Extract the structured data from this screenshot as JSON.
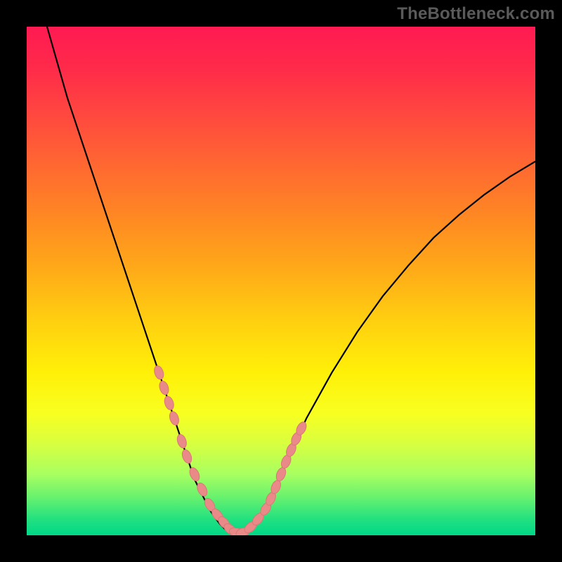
{
  "watermark": "TheBottleneck.com",
  "chart_data": {
    "type": "line",
    "title": "",
    "xlabel": "",
    "ylabel": "",
    "xlim": [
      0,
      100
    ],
    "ylim": [
      0,
      100
    ],
    "grid": false,
    "series": [
      {
        "name": "curve",
        "x": [
          4,
          6,
          8,
          10,
          12,
          14,
          16,
          18,
          20,
          22,
          24,
          26,
          28,
          30,
          31,
          32,
          33,
          34,
          35,
          36,
          37,
          38,
          39,
          40,
          41,
          42,
          43,
          44,
          45,
          46,
          48,
          50,
          52,
          55,
          60,
          65,
          70,
          75,
          80,
          85,
          90,
          95,
          100
        ],
        "y": [
          100,
          93,
          86,
          80,
          74,
          68,
          62,
          56,
          50,
          44,
          38,
          32,
          26,
          20,
          17,
          14,
          11,
          9,
          7,
          5,
          3.5,
          2.2,
          1.2,
          0.6,
          0.3,
          0.2,
          0.5,
          1.2,
          2.3,
          3.7,
          7.5,
          12,
          16.5,
          23,
          32,
          40,
          47,
          53,
          58.5,
          63,
          67,
          70.5,
          73.5
        ]
      }
    ],
    "bead_points": {
      "comment": "pink oval markers drawn along lower portion of V-curve",
      "x": [
        26,
        27,
        28,
        29,
        30.5,
        31.5,
        33,
        34.5,
        36,
        37.5,
        38.8,
        40,
        41.2,
        42.5,
        44,
        45.5,
        47,
        48,
        49,
        50,
        51,
        52,
        53,
        54
      ],
      "y": [
        32,
        29,
        26,
        23,
        18.5,
        15.5,
        12,
        9,
        6,
        4,
        2.5,
        1.2,
        0.6,
        0.6,
        1.6,
        3.2,
        5.2,
        7.2,
        9.5,
        12,
        14.5,
        16.8,
        19,
        21
      ]
    },
    "colors": {
      "curve_stroke": "#000000",
      "bead_fill": "#e98a88",
      "bead_stroke": "#d97876"
    }
  }
}
